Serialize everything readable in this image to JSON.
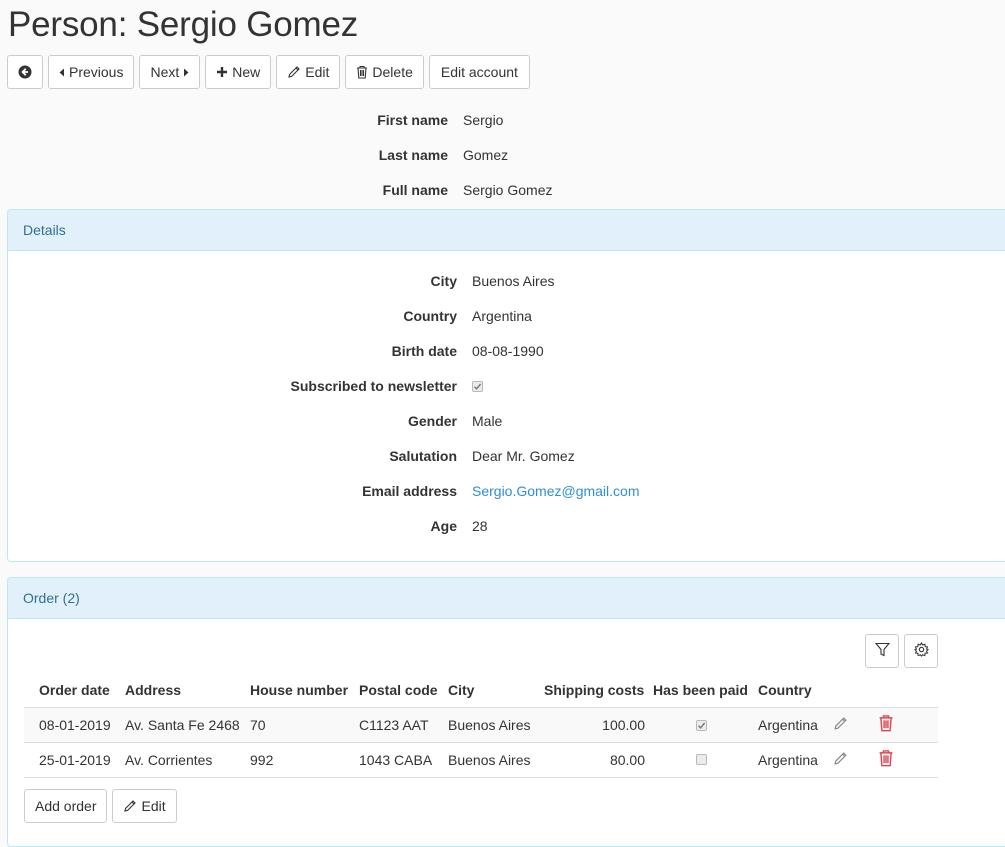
{
  "page": {
    "title": "Person: Sergio Gomez"
  },
  "toolbar": {
    "previous": "Previous",
    "next": "Next",
    "new": "New",
    "edit": "Edit",
    "delete": "Delete",
    "edit_account": "Edit account"
  },
  "person": [
    {
      "label": "First name",
      "value": "Sergio"
    },
    {
      "label": "Last name",
      "value": "Gomez"
    },
    {
      "label": "Full name",
      "value": "Sergio Gomez"
    }
  ],
  "details": {
    "heading": "Details",
    "city": {
      "label": "City",
      "value": "Buenos Aires"
    },
    "country": {
      "label": "Country",
      "value": "Argentina"
    },
    "birth_date": {
      "label": "Birth date",
      "value": "08-08-1990"
    },
    "newsletter": {
      "label": "Subscribed to newsletter",
      "checked": true
    },
    "gender": {
      "label": "Gender",
      "value": "Male"
    },
    "salutation": {
      "label": "Salutation",
      "value": "Dear Mr. Gomez"
    },
    "email": {
      "label": "Email address",
      "value": "Sergio.Gomez@gmail.com"
    },
    "age": {
      "label": "Age",
      "value": "28"
    }
  },
  "orders": {
    "heading": "Order (2)",
    "columns": [
      "Order date",
      "Address",
      "House number",
      "Postal code",
      "City",
      "Shipping costs",
      "Has been paid",
      "Country"
    ],
    "rows": [
      {
        "order_date": "08-01-2019",
        "address": "Av. Santa Fe 2468",
        "house_number": "70",
        "postal_code": "C1123 AAT",
        "city": "Buenos Aires",
        "shipping_costs": "100.00",
        "paid": true,
        "country": "Argentina"
      },
      {
        "order_date": "25-01-2019",
        "address": "Av. Corrientes",
        "house_number": "992",
        "postal_code": "1043 CABA",
        "city": "Buenos Aires",
        "shipping_costs": "80.00",
        "paid": false,
        "country": "Argentina"
      }
    ],
    "add_order": "Add order",
    "edit": "Edit"
  },
  "colors": {
    "panel_heading_bg": "#e2f0fc",
    "panel_heading_text": "#31708f",
    "link": "#2d8fd5",
    "delete_icon": "#e0454f"
  },
  "icons": [
    "back-circle-icon",
    "caret-left-icon",
    "caret-right-icon",
    "plus-icon",
    "pencil-icon",
    "trash-icon",
    "filter-icon",
    "gear-icon"
  ]
}
